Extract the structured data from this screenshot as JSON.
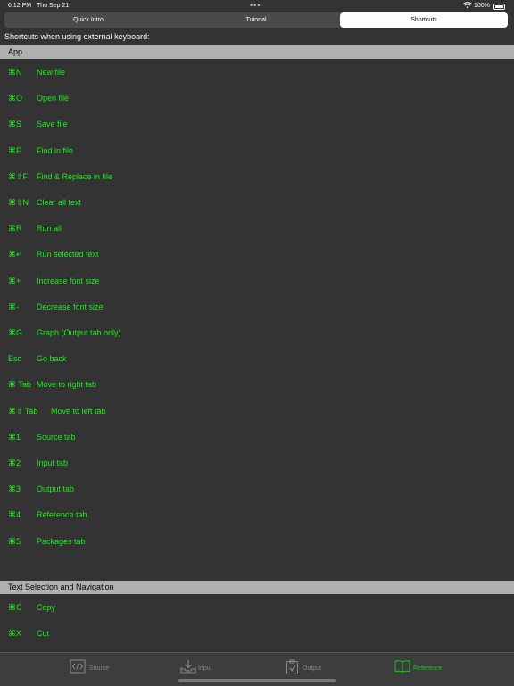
{
  "status_bar": {
    "time": "6:12 PM",
    "date": "Thu Sep 21",
    "dots": "•••",
    "battery_pct": "100%"
  },
  "tabs": [
    {
      "label": "Quick Intro"
    },
    {
      "label": "Tutorial"
    },
    {
      "label": "Shortcuts"
    }
  ],
  "subtitle": "Shortcuts when using external keyboard:",
  "sections": [
    {
      "title": "App",
      "items": [
        {
          "key": "⌘N",
          "desc": "New file"
        },
        {
          "key": "⌘O",
          "desc": "Open file"
        },
        {
          "key": "⌘S",
          "desc": "Save file"
        },
        {
          "key": "⌘F",
          "desc": "Find in file"
        },
        {
          "key": "⌘⇧F",
          "desc": "Find & Replace in file"
        },
        {
          "key": "⌘⇧N",
          "desc": "Clear all text"
        },
        {
          "key": "⌘R",
          "desc": "Run all"
        },
        {
          "key": "⌘↵",
          "desc": "Run selected text"
        },
        {
          "key": "⌘+",
          "desc": "Increase font size"
        },
        {
          "key": "⌘-",
          "desc": "Decrease font size"
        },
        {
          "key": "⌘G",
          "desc": "Graph (Output tab only)"
        },
        {
          "key": "Esc",
          "desc": "Go back"
        },
        {
          "key": "⌘ Tab",
          "desc": "Move to right tab"
        },
        {
          "key": "⌘⇧ Tab",
          "desc": "Move to left tab"
        },
        {
          "key": "⌘1",
          "desc": "Source tab"
        },
        {
          "key": "⌘2",
          "desc": "Input tab"
        },
        {
          "key": "⌘3",
          "desc": "Output tab"
        },
        {
          "key": "⌘4",
          "desc": "Reference tab"
        },
        {
          "key": "⌘5",
          "desc": "Packages tab"
        }
      ]
    },
    {
      "title": "Text Selection and Navigation",
      "items": [
        {
          "key": "⌘C",
          "desc": "Copy"
        },
        {
          "key": "⌘X",
          "desc": "Cut"
        }
      ]
    }
  ],
  "bottom_tabs": [
    {
      "label": "Source",
      "icon": "code-icon"
    },
    {
      "label": "Input",
      "icon": "inbox-download-icon"
    },
    {
      "label": "Output",
      "icon": "clipboard-check-icon"
    },
    {
      "label": "Reference",
      "icon": "book-icon"
    }
  ],
  "colors": {
    "background": "#333333",
    "shortcut_text": "#19ee19",
    "section_header": "#b0b0b0",
    "active_tab": "#19c819"
  }
}
